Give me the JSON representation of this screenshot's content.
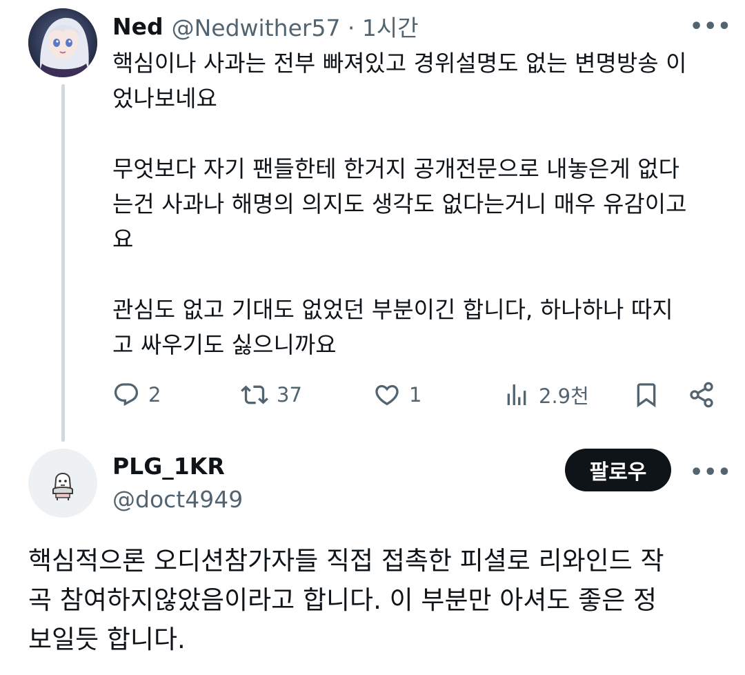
{
  "reply": {
    "author_name": "Ned",
    "handle_and_time": "@Nedwither57 · 1시간",
    "paragraphs": [
      "핵심이나 사과는 전부 빠져있고 경위설명도 없는 변명방송 이\n었나보네요",
      "무엇보다 자기 팬들한테 한거지 공개전문으로 내놓은게 없다\n는건 사과나 해명의 의지도 생각도 없다는거니 매우 유감이고\n요",
      "관심도 없고 기대도 없었던 부분이긴 합니다, 하나하나 따지\n고 싸우기도 싫으니까요"
    ],
    "stats": {
      "replies": "2",
      "reposts": "37",
      "likes": "1",
      "views": "2.9천"
    }
  },
  "main": {
    "author_name": "PLG_1KR",
    "handle": "@doct4949",
    "follow_label": "팔로우",
    "text": "핵심적으론 오디션참가자들 직접 접촉한 피셜로 리와인드 작\n곡 참여하지않았음이라고 합니다. 이 부분만 아셔도 좋은 정\n보일듯 합니다."
  },
  "icons": {
    "more": "more-horizontal-icon",
    "reply": "reply-icon",
    "repost": "repost-icon",
    "like": "heart-icon",
    "views": "views-icon",
    "bookmark": "bookmark-icon",
    "share": "share-icon"
  },
  "colors": {
    "text_primary": "#0f1419",
    "text_secondary": "#536471",
    "thread_line": "#cfd9de",
    "follow_button_bg": "#0f1419"
  }
}
